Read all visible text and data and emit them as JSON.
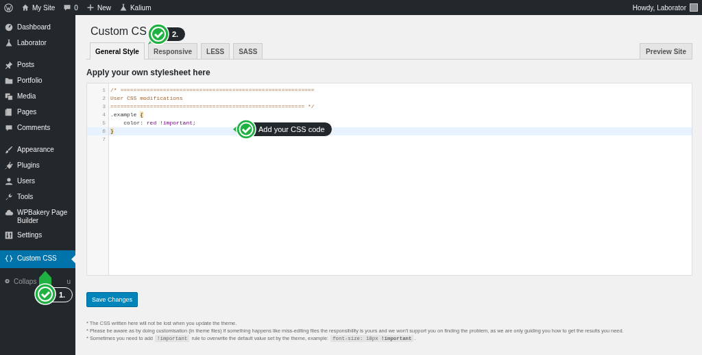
{
  "admin_bar": {
    "left": [
      {
        "label": "My Site"
      },
      {
        "label": "0"
      },
      {
        "label": "New"
      },
      {
        "label": "Kalium"
      }
    ],
    "greeting": "Howdy, Laborator"
  },
  "sidebar": {
    "groups": [
      [
        {
          "label": "Dashboard",
          "selected": false
        },
        {
          "label": "Laborator",
          "selected": false
        }
      ],
      [
        {
          "label": "Posts",
          "selected": false
        },
        {
          "label": "Portfolio",
          "selected": false
        },
        {
          "label": "Media",
          "selected": false
        },
        {
          "label": "Pages",
          "selected": false
        },
        {
          "label": "Comments",
          "selected": false
        }
      ],
      [
        {
          "label": "Appearance",
          "selected": false
        },
        {
          "label": "Plugins",
          "selected": false
        },
        {
          "label": "Users",
          "selected": false
        },
        {
          "label": "Tools",
          "selected": false
        },
        {
          "label": "WPBakery Page Builder",
          "selected": false
        },
        {
          "label": "Settings",
          "selected": false
        }
      ],
      [
        {
          "label": "Custom CSS",
          "selected": true
        }
      ]
    ],
    "collapse": {
      "parts": [
        "Collaps",
        "u"
      ]
    }
  },
  "page": {
    "title": "Custom CS",
    "tabs": [
      {
        "label": "General Style",
        "selected": true
      },
      {
        "label": "Responsive",
        "selected": false
      },
      {
        "label": "LESS",
        "selected": false
      },
      {
        "label": "SASS",
        "selected": false
      }
    ],
    "preview_button": "Preview Site",
    "heading": "Apply your own stylesheet here",
    "editor": {
      "lines": [
        {
          "number": "1",
          "highlighted": false,
          "tokens": [
            {
              "kind": "comment",
              "text": "/* ==========================================================="
            }
          ]
        },
        {
          "number": "2",
          "highlighted": false,
          "tokens": [
            {
              "kind": "comment",
              "text": "User CSS modifications"
            }
          ]
        },
        {
          "number": "3",
          "highlighted": false,
          "tokens": [
            {
              "kind": "comment",
              "text": "=========================================================== */"
            }
          ]
        },
        {
          "number": "4",
          "highlighted": false,
          "tokens": [
            {
              "kind": "plain",
              "text": ".example "
            },
            {
              "kind": "brace",
              "text": "{"
            }
          ]
        },
        {
          "number": "5",
          "highlighted": false,
          "tokens": [
            {
              "kind": "plain",
              "text": "    color: "
            },
            {
              "kind": "value",
              "text": "red !important"
            },
            {
              "kind": "plain",
              "text": ";"
            }
          ]
        },
        {
          "number": "6",
          "highlighted": true,
          "tokens": [
            {
              "kind": "brace",
              "text": "}"
            }
          ]
        },
        {
          "number": "7",
          "highlighted": false
        }
      ]
    },
    "save_button": "Save Changes",
    "notes": [
      [
        {
          "kind": "text",
          "text": "* The CSS written here will not be lost when you update the theme."
        }
      ],
      [
        {
          "kind": "text",
          "text": "* Please be aware as by doing customisation (in theme files) if something happens like miss-editing files the responsibility is yours and we won't support you on finding the problem, as we are only guiding you how to get the results you need."
        }
      ],
      [
        {
          "kind": "text",
          "text": "* Sometimes you need to add "
        },
        {
          "kind": "code",
          "text": "!important"
        },
        {
          "kind": "text",
          "text": " rule to overwrite the default value set by the theme, example: "
        },
        {
          "kind": "code",
          "text": "font-size: 18px **!important**"
        },
        {
          "kind": "text",
          "text": "."
        }
      ]
    ]
  },
  "callouts": [
    {
      "label": "2."
    },
    {
      "label": "Add your CSS code"
    },
    {
      "label": "1."
    }
  ]
}
